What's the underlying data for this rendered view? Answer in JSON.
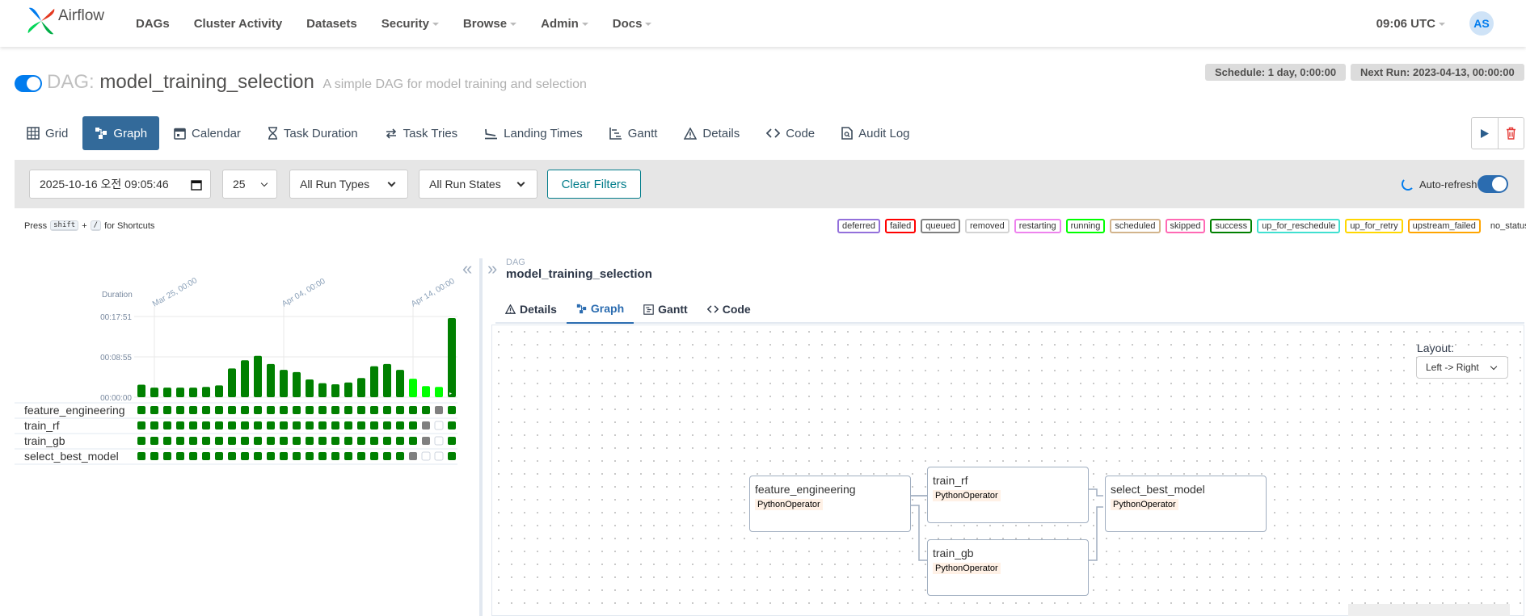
{
  "app": {
    "brand": "Airflow",
    "nav": [
      "DAGs",
      "Cluster Activity",
      "Datasets",
      "Security",
      "Browse",
      "Admin",
      "Docs"
    ],
    "time": "09:06 UTC",
    "user_initials": "AS"
  },
  "dag": {
    "label": "DAG:",
    "id": "model_training_selection",
    "description": "A simple DAG for model training and selection",
    "schedule": "Schedule: 1 day, 0:00:00",
    "next_run": "Next Run: 2023-04-13, 00:00:00"
  },
  "tabs": [
    "Grid",
    "Graph",
    "Calendar",
    "Task Duration",
    "Task Tries",
    "Landing Times",
    "Gantt",
    "Details",
    "Code",
    "Audit Log"
  ],
  "filters": {
    "base_date": "2025-10-16 오전 09:05:46",
    "num_runs": "25",
    "run_type": "All Run Types",
    "run_state": "All Run States",
    "clear": "Clear Filters",
    "auto_refresh": "Auto-refresh"
  },
  "shortcuts": {
    "press": "Press",
    "key1": "shift",
    "plus": "+",
    "key2": "/",
    "suffix": "for Shortcuts"
  },
  "legend": [
    {
      "label": "deferred",
      "color": "#9370db"
    },
    {
      "label": "failed",
      "color": "#ff0000"
    },
    {
      "label": "queued",
      "color": "#808080"
    },
    {
      "label": "removed",
      "color": "#d3d3d3"
    },
    {
      "label": "restarting",
      "color": "#ee82ee"
    },
    {
      "label": "running",
      "color": "#00ff00"
    },
    {
      "label": "scheduled",
      "color": "#d2b48c"
    },
    {
      "label": "skipped",
      "color": "#ff69b4"
    },
    {
      "label": "success",
      "color": "#008000"
    },
    {
      "label": "up_for_reschedule",
      "color": "#40e0d0"
    },
    {
      "label": "up_for_retry",
      "color": "#ffd700"
    },
    {
      "label": "upstream_failed",
      "color": "#ffa500"
    },
    {
      "label": "no_status",
      "color": ""
    }
  ],
  "grid": {
    "duration_label": "Duration",
    "y_ticks": [
      "00:17:51",
      "00:08:55",
      "00:00:00"
    ],
    "x_dates": [
      "Mar 25, 00:00",
      "Apr 04, 00:00",
      "Apr 14, 00:00"
    ],
    "run_durations_sec": [
      170,
      130,
      130,
      130,
      130,
      140,
      160,
      390,
      500,
      560,
      450,
      370,
      340,
      240,
      190,
      175,
      200,
      260,
      420,
      450,
      370,
      250,
      150,
      140,
      1071
    ],
    "run_states": [
      "success",
      "success",
      "success",
      "success",
      "success",
      "success",
      "success",
      "success",
      "success",
      "success",
      "success",
      "success",
      "success",
      "success",
      "success",
      "success",
      "success",
      "success",
      "success",
      "success",
      "success",
      "running",
      "running",
      "running",
      "success"
    ],
    "tasks": [
      {
        "name": "feature_engineering",
        "states": [
          "success",
          "success",
          "success",
          "success",
          "success",
          "success",
          "success",
          "success",
          "success",
          "success",
          "success",
          "success",
          "success",
          "success",
          "success",
          "success",
          "success",
          "success",
          "success",
          "success",
          "success",
          "success",
          "success",
          "queued",
          "success"
        ]
      },
      {
        "name": "train_rf",
        "states": [
          "success",
          "success",
          "success",
          "success",
          "success",
          "success",
          "success",
          "success",
          "success",
          "success",
          "success",
          "success",
          "success",
          "success",
          "success",
          "success",
          "success",
          "success",
          "success",
          "success",
          "success",
          "success",
          "queued",
          "none",
          "success"
        ]
      },
      {
        "name": "train_gb",
        "states": [
          "success",
          "success",
          "success",
          "success",
          "success",
          "success",
          "success",
          "success",
          "success",
          "success",
          "success",
          "success",
          "success",
          "success",
          "success",
          "success",
          "success",
          "success",
          "success",
          "success",
          "success",
          "success",
          "queued",
          "none",
          "success"
        ]
      },
      {
        "name": "select_best_model",
        "states": [
          "success",
          "success",
          "success",
          "success",
          "success",
          "success",
          "success",
          "success",
          "success",
          "success",
          "success",
          "success",
          "success",
          "success",
          "success",
          "success",
          "success",
          "success",
          "success",
          "success",
          "success",
          "queued",
          "none",
          "none",
          "success"
        ]
      }
    ]
  },
  "detail": {
    "crumb": "DAG",
    "name": "model_training_selection",
    "tabs": [
      "Details",
      "Graph",
      "Gantt",
      "Code"
    ],
    "layout_label": "Layout:",
    "layout_value": "Left -> Right",
    "nodes": [
      {
        "name": "feature_engineering",
        "operator": "PythonOperator"
      },
      {
        "name": "train_rf",
        "operator": "PythonOperator"
      },
      {
        "name": "train_gb",
        "operator": "PythonOperator"
      },
      {
        "name": "select_best_model",
        "operator": "PythonOperator"
      }
    ]
  },
  "colors": {
    "accent": "#017cee",
    "active_tab": "#336a9a",
    "success": "#008000",
    "running": "#00ff00",
    "queued": "#808080"
  }
}
